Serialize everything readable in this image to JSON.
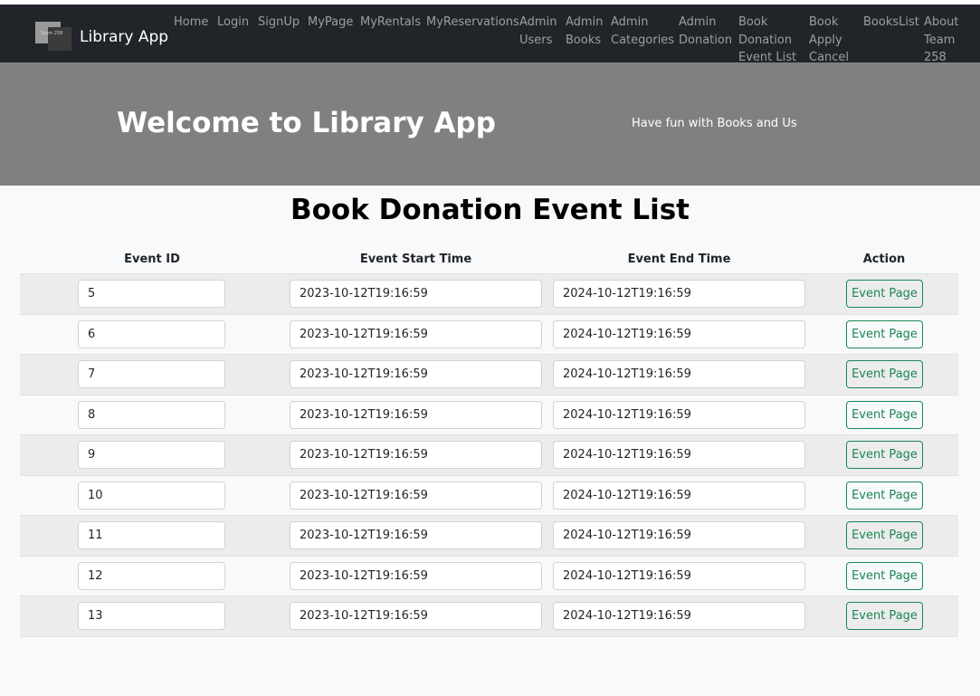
{
  "brand": {
    "name": "Library App",
    "logo_text": "Team 258"
  },
  "nav": {
    "items": [
      {
        "label": "Home",
        "active": true
      },
      {
        "label": "Login",
        "active": false
      },
      {
        "label": "SignUp",
        "active": false
      },
      {
        "label": "MyPage",
        "active": false
      },
      {
        "label": "MyRentals",
        "active": false
      },
      {
        "label": "MyReservations",
        "active": false
      },
      {
        "label": "Admin\nUsers",
        "active": false
      },
      {
        "label": "Admin\nBooks",
        "active": false
      },
      {
        "label": "Admin\nCategories",
        "active": false
      },
      {
        "label": "Admin\nDonation",
        "active": false
      },
      {
        "label": "Book\nDonation\nEvent List",
        "active": false
      },
      {
        "label": "Book\nApply\nCancel",
        "active": false
      },
      {
        "label": "BooksList",
        "active": false
      },
      {
        "label": "About\nTeam\n258",
        "active": true
      }
    ]
  },
  "hero": {
    "title": "Welcome to Library App",
    "subtitle": "Have fun with Books and Us"
  },
  "page": {
    "title": "Book Donation Event List"
  },
  "table": {
    "headers": [
      "Event ID",
      "Event Start Time",
      "Event End Time",
      "Action"
    ],
    "action_label": "Event Page",
    "rows": [
      {
        "id": "5",
        "start": "2023-10-12T19:16:59",
        "end": "2024-10-12T19:16:59"
      },
      {
        "id": "6",
        "start": "2023-10-12T19:16:59",
        "end": "2024-10-12T19:16:59"
      },
      {
        "id": "7",
        "start": "2023-10-12T19:16:59",
        "end": "2024-10-12T19:16:59"
      },
      {
        "id": "8",
        "start": "2023-10-12T19:16:59",
        "end": "2024-10-12T19:16:59"
      },
      {
        "id": "9",
        "start": "2023-10-12T19:16:59",
        "end": "2024-10-12T19:16:59"
      },
      {
        "id": "10",
        "start": "2023-10-12T19:16:59",
        "end": "2024-10-12T19:16:59"
      },
      {
        "id": "11",
        "start": "2023-10-12T19:16:59",
        "end": "2024-10-12T19:16:59"
      },
      {
        "id": "12",
        "start": "2023-10-12T19:16:59",
        "end": "2024-10-12T19:16:59"
      },
      {
        "id": "13",
        "start": "2023-10-12T19:16:59",
        "end": "2024-10-12T19:16:59"
      }
    ]
  },
  "colors": {
    "navbar": "#212529",
    "hero": "#808080",
    "page_bg": "#f8f9fa",
    "button_outline": "#198754",
    "stripe": "#ececec"
  }
}
